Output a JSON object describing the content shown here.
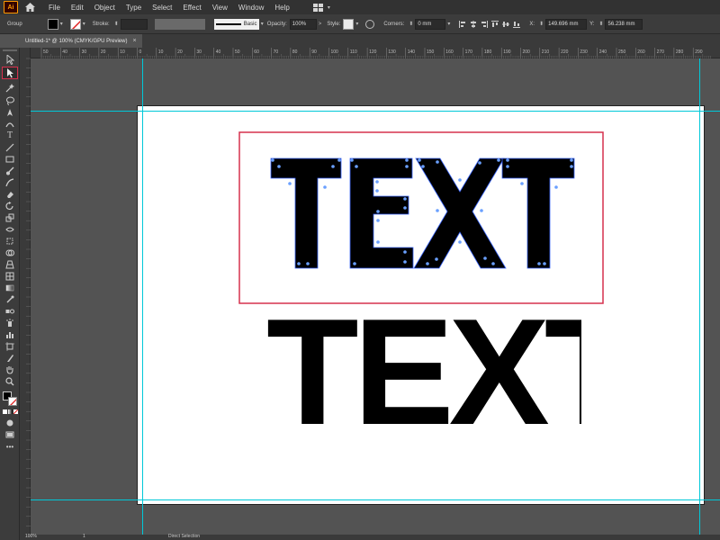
{
  "app": {
    "logo_text": "Ai"
  },
  "menu": {
    "items": [
      "File",
      "Edit",
      "Object",
      "Type",
      "Select",
      "Effect",
      "View",
      "Window",
      "Help"
    ]
  },
  "control": {
    "selection_label": "Group",
    "stroke_label": "Stroke:",
    "brush_label": "Basic",
    "opacity_label": "Opacity:",
    "opacity_value": "100%",
    "style_label": "Style:",
    "corners_label": "Corners:",
    "corners_value": "0 mm",
    "x_label": "X:",
    "x_value": "149.696 mm",
    "y_label": "Y:",
    "y_value": "56.238 mm"
  },
  "document": {
    "tab_title": "Untitled-1* @ 100% (CMYK/GPU Preview)"
  },
  "ruler": {
    "labels": [
      "50",
      "40",
      "30",
      "20",
      "10",
      "0",
      "10",
      "20",
      "30",
      "40",
      "50",
      "60",
      "70",
      "80",
      "90",
      "100",
      "110",
      "120",
      "130",
      "140",
      "150",
      "160",
      "170",
      "180",
      "190",
      "200",
      "210",
      "220",
      "230",
      "240",
      "250",
      "260",
      "270",
      "280",
      "290"
    ]
  },
  "artwork": {
    "word": "TEXT"
  },
  "status": {
    "zoom": "100%",
    "page": "1",
    "tool": "Direct Selection"
  },
  "colors": {
    "selection_box": "#d6304d",
    "guide": "#00c8d8",
    "anchor": "#6aa0ff"
  }
}
